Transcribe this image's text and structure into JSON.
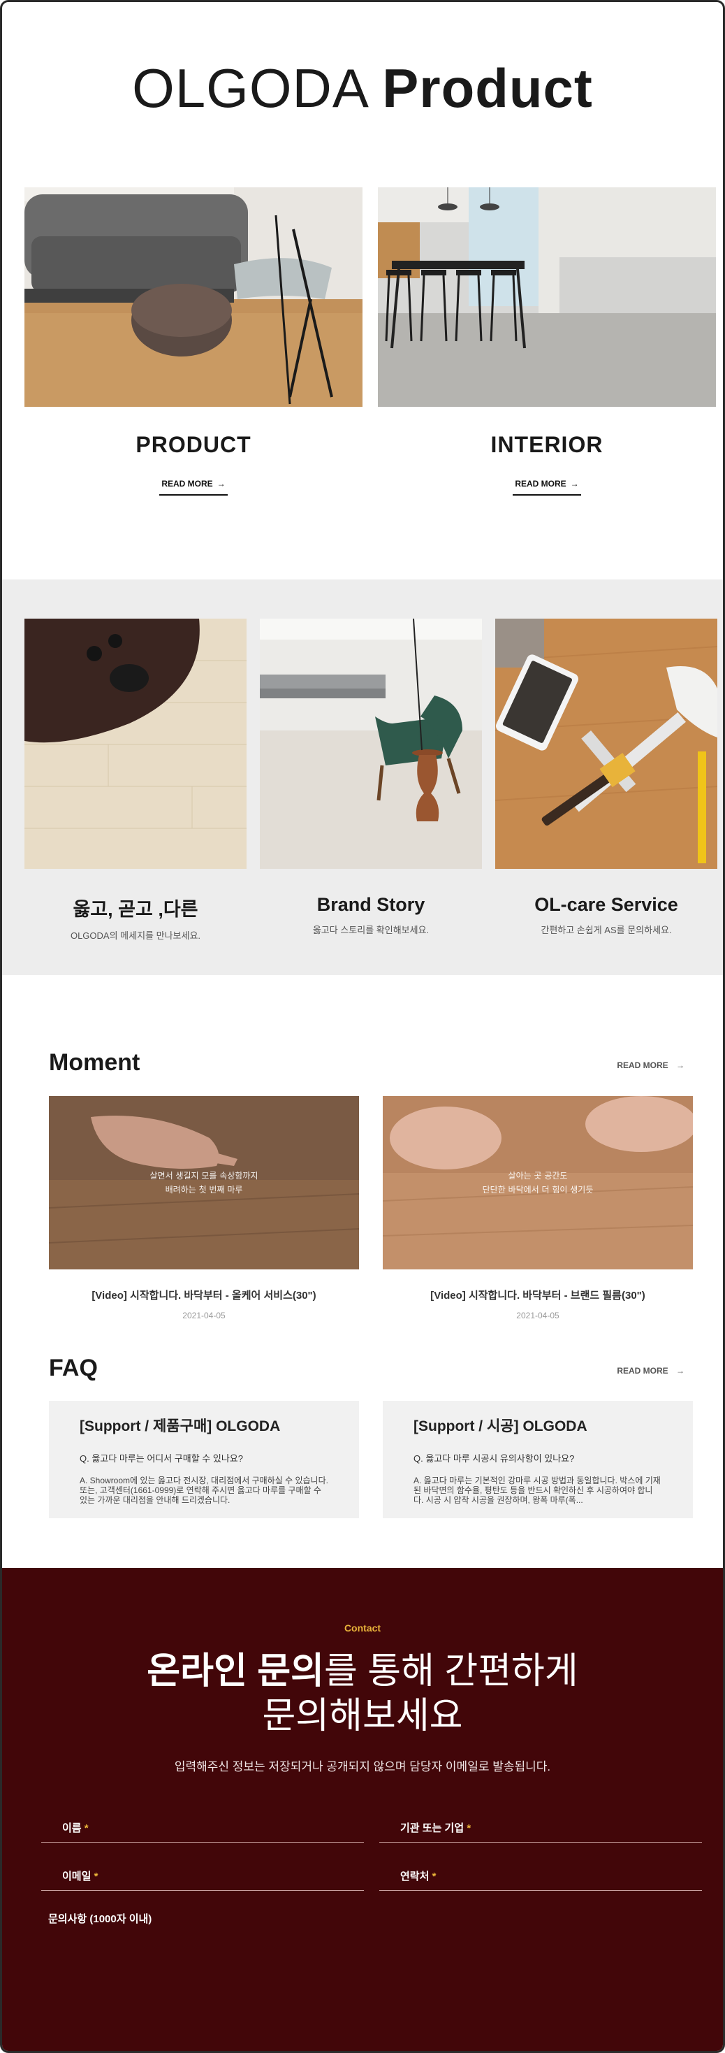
{
  "header": {
    "title_light": "OLGODA",
    "title_bold": "Product"
  },
  "showcase": [
    {
      "name": "PRODUCT",
      "link": "READ MORE"
    },
    {
      "name": "INTERIOR",
      "link": "READ MORE"
    }
  ],
  "band": [
    {
      "title": "옳고, 곧고 ,다른",
      "sub": "OLGODA의 메세지를 만나보세요."
    },
    {
      "title": "Brand Story",
      "sub": "옳고다 스토리를 확인해보세요."
    },
    {
      "title": "OL-care Service",
      "sub": "간편하고 손쉽게 AS를 문의하세요."
    }
  ],
  "moment": {
    "title": "Moment",
    "more": "READ MORE",
    "videos": [
      {
        "caption1": "살면서 생길지 모를 속상함까지",
        "caption2": "배려하는 첫 번째 마루",
        "title": "[Video] 시작합니다. 바닥부터 - 올케어 서비스(30\")",
        "date": "2021-04-05"
      },
      {
        "caption1": "살아는 곳 공간도",
        "caption2": "단단한 바닥에서 더 힘이 생기듯",
        "title": "[Video] 시작합니다. 바닥부터 - 브랜드 필름(30\")",
        "date": "2021-04-05"
      }
    ]
  },
  "faq": {
    "title": "FAQ",
    "more": "READ MORE",
    "items": [
      {
        "title": "[Support / 제품구매] OLGODA",
        "q": "Q. 옳고다 마루는 어디서 구매할 수 있나요?",
        "a": "A. Showroom에 있는 옳고다 전시장, 대리점에서 구매하실 수 있습니다. 또는, 고객센터(1661-0999)로 연락해 주시면 옳고다 마루를 구매할 수 있는 가까운 대리점을 안내해 드리겠습니다."
      },
      {
        "title": "[Support / 시공] OLGODA",
        "q": "Q. 옳고다 마루 시공시 유의사항이 있나요?",
        "a": "A. 옳고다 마루는 기본적인 강마루 시공 방법과 동일합니다. 박스에 기재된 바닥면의 함수율, 평탄도 등을 반드시 확인하신 후 시공하여야 합니다. 시공 시 압착 시공을 권장하며, 왕폭 마루(폭..."
      }
    ]
  },
  "contact": {
    "label": "Contact",
    "head_bold": "온라인 문의",
    "head_rest": "를 통해 간편하게",
    "head_line2": "문의해보세요",
    "desc": "입력해주신 정보는 저장되거나 공개되지 않으며 담당자 이메일로 발송됩니다.",
    "fields": {
      "name": "이름",
      "org": "기관 또는 기업",
      "email": "이메일",
      "phone": "연락처",
      "message": "문의사항 (1000자 이내)"
    },
    "req": "*"
  }
}
